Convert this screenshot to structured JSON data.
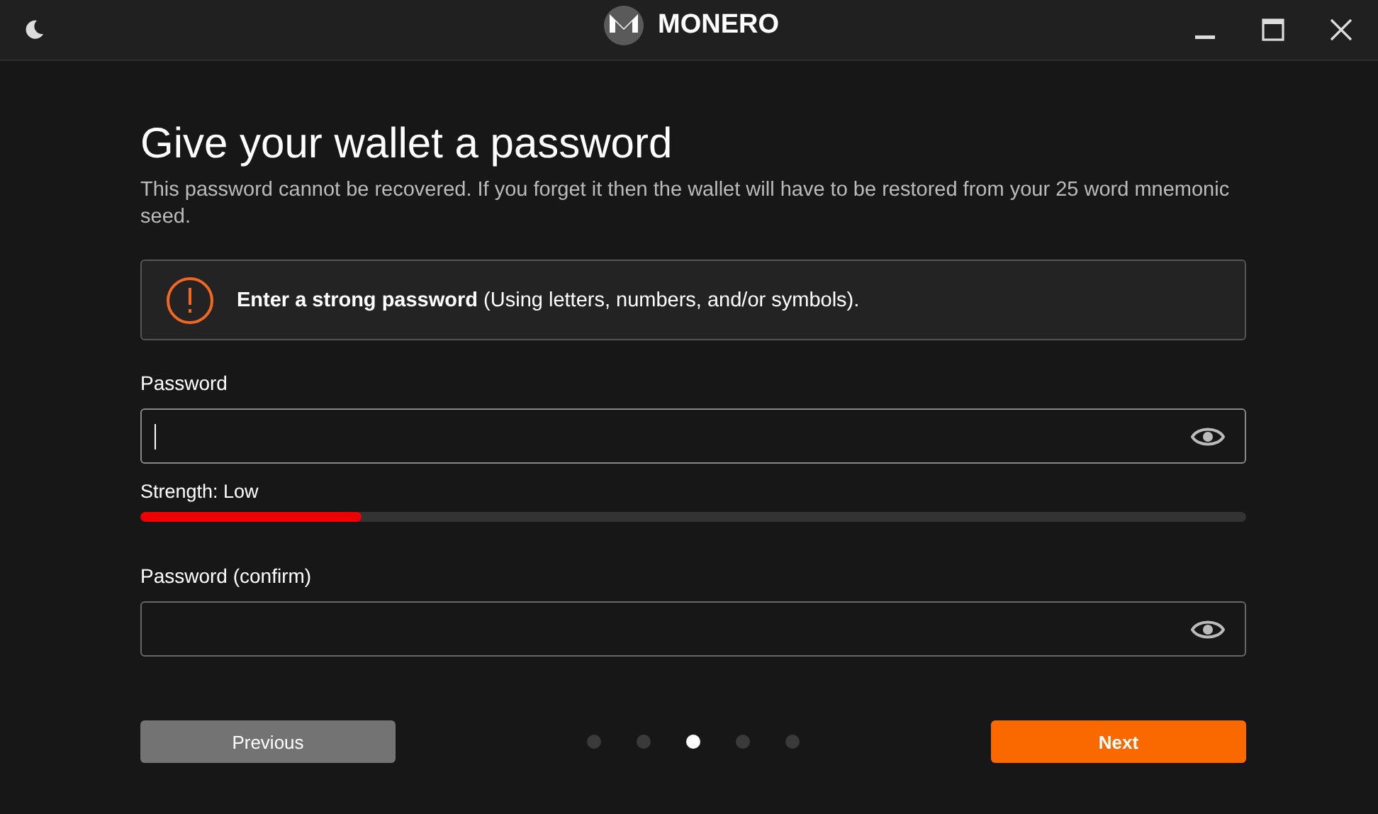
{
  "window": {
    "title": "MONERO"
  },
  "heading": "Give your wallet a password",
  "description": "This password cannot be recovered. If you forget it then the wallet will have to be restored from your 25 word mnemonic seed.",
  "notice": {
    "text": "**Enter a strong password** (Using letters, numbers, and/or symbols)."
  },
  "password": {
    "label": "Password",
    "focused": true
  },
  "strength": {
    "label": "Strength: Low",
    "level": 0.2
  },
  "confirm": {
    "label": "Password (confirm)",
    "focused": false
  },
  "steps": [
    {
      "selected": false
    },
    {
      "selected": false
    },
    {
      "selected": true
    },
    {
      "selected": false
    },
    {
      "selected": false
    }
  ],
  "buttons": {
    "previous": "Previous",
    "next": "Next"
  }
}
